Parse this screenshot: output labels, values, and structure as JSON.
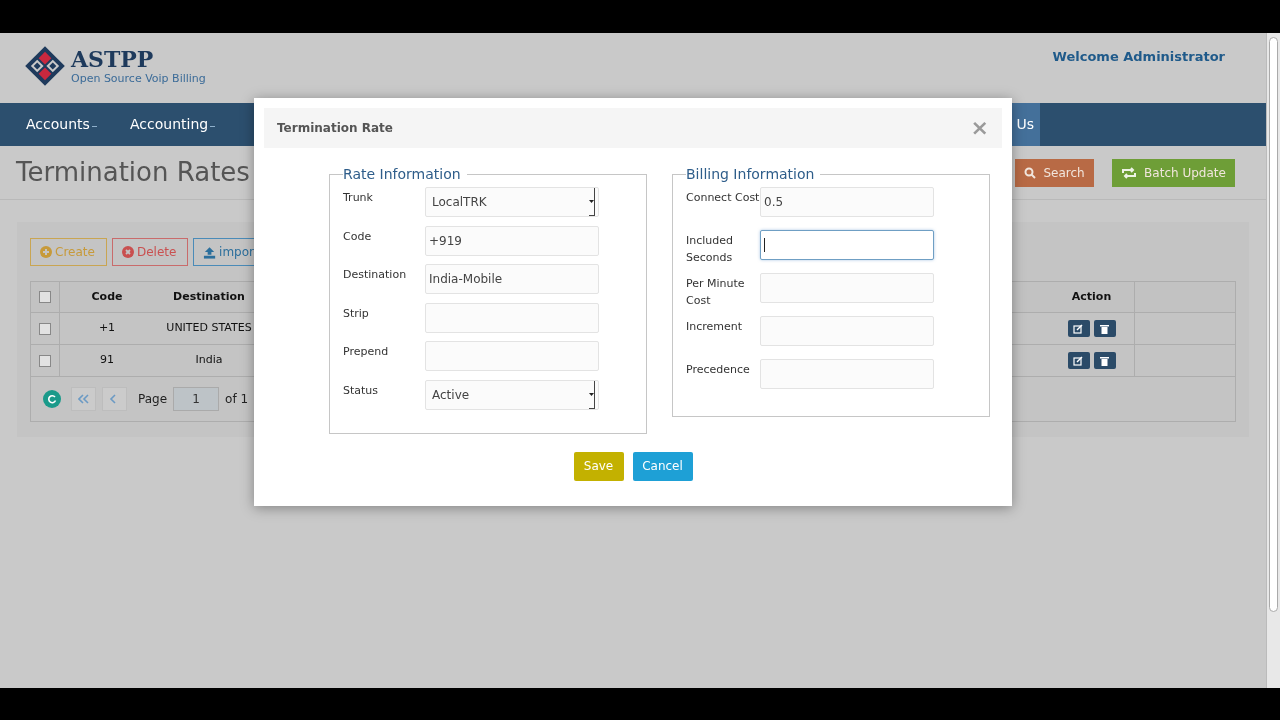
{
  "header": {
    "logo_title": "ASTPP",
    "logo_subtitle": "Open Source Voip Billing",
    "welcome": "Welcome Administrator"
  },
  "nav": [
    {
      "label": "Accounts",
      "dropdown": true,
      "highlighted": false
    },
    {
      "label": "Accounting",
      "dropdown": true,
      "highlighted": false
    },
    {
      "label": "Us",
      "dropdown": false,
      "highlighted": true
    }
  ],
  "page_title": "Termination Rates",
  "toolbar_buttons": [
    {
      "label": "Search",
      "kind": "search"
    },
    {
      "label": "Batch Update",
      "kind": "batch"
    }
  ],
  "action_buttons": [
    {
      "label": "Create",
      "kind": "create"
    },
    {
      "label": "Delete",
      "kind": "delete"
    },
    {
      "label": "impor",
      "kind": "import"
    }
  ],
  "table": {
    "header_checked": false,
    "columns_left": [
      "Code",
      "Destination"
    ],
    "columns_right": [
      "Action"
    ],
    "rows": [
      {
        "checked": false,
        "code": "+1",
        "destination": "UNITED STATES"
      },
      {
        "checked": false,
        "code": "91",
        "destination": "India"
      }
    ]
  },
  "pagination": {
    "page_label": "Page",
    "page": "1",
    "of": "of 1"
  },
  "modal": {
    "title": "Termination Rate",
    "close": "×",
    "fieldsets": [
      {
        "legend": "Rate Information",
        "fields": [
          {
            "label": "Trunk",
            "kind": "select",
            "value": "LocalTRK",
            "focused": false
          },
          {
            "label": "Code",
            "kind": "text",
            "value": "+919",
            "focused": false
          },
          {
            "label": "Destination",
            "kind": "text",
            "value": "India-Mobile",
            "focused": false
          },
          {
            "label": "Strip",
            "kind": "text",
            "focused": false
          },
          {
            "label": "Prepend",
            "kind": "text",
            "focused": false
          },
          {
            "label": "Status",
            "kind": "select",
            "value": "Active",
            "focused": false
          }
        ]
      },
      {
        "legend": "Billing Information",
        "fields": [
          {
            "label": "Connect Cost",
            "kind": "text",
            "value": "0.5",
            "focused": false
          },
          {
            "label": "Included Seconds",
            "kind": "text",
            "focused": true
          },
          {
            "label": "Per Minute Cost",
            "kind": "text",
            "focused": false
          },
          {
            "label": "Increment",
            "kind": "text",
            "focused": false
          },
          {
            "label": "Precedence",
            "kind": "text",
            "focused": false
          }
        ]
      }
    ],
    "buttons": [
      {
        "label": "Save",
        "kind": "save"
      },
      {
        "label": "Cancel",
        "kind": "cancel"
      }
    ]
  }
}
